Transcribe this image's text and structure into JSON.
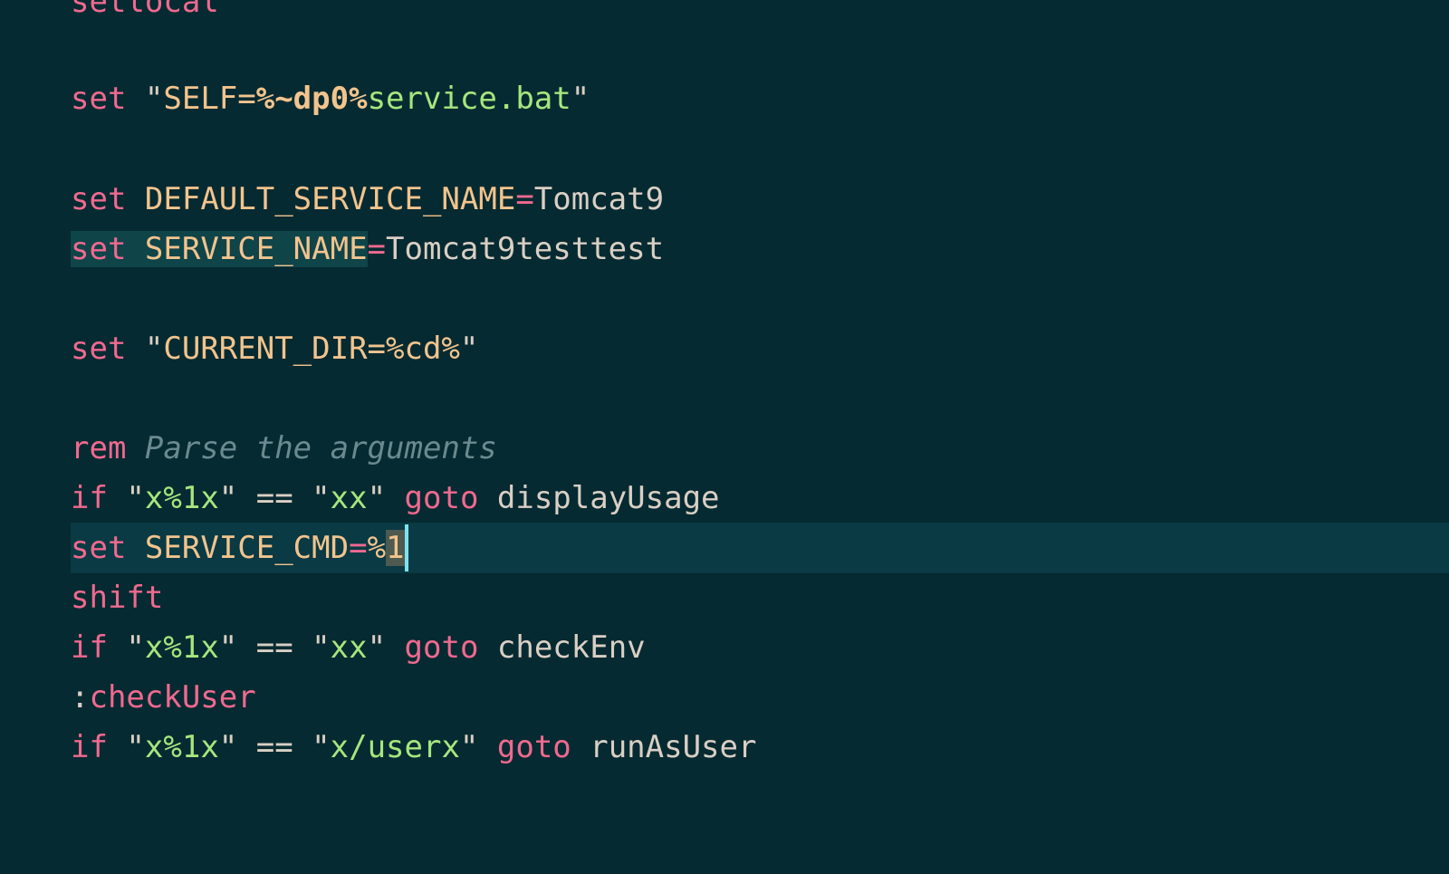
{
  "editor": {
    "lines": [
      {
        "t1": "setlocal"
      },
      {
        "t1": "set",
        "t2": " \"",
        "t3": "SELF=",
        "t4": "%~dp0%",
        "t5": "service.bat",
        "t6": "\""
      },
      {
        "t1": "set",
        "t2": " ",
        "t3": "DEFAULT_SERVICE_NAME",
        "t4": "=",
        "t5": "Tomcat9"
      },
      {
        "t1": "set",
        "t2": " ",
        "t3": "SERVICE_NAME",
        "t4": "=",
        "t5": "Tomcat9testtest"
      },
      {
        "t1": "set",
        "t2": " \"",
        "t3": "CURRENT_DIR=",
        "t4": "%cd%",
        "t5": "\""
      },
      {
        "t1": "rem",
        "t2": " ",
        "t3": "Parse the arguments"
      },
      {
        "t1": "if",
        "t2": " \"",
        "t3": "x%1x",
        "t4": "\" == \"",
        "t5": "xx",
        "t6": "\" ",
        "t7": "goto",
        "t8": " displayUsage"
      },
      {
        "t1": "set",
        "t2": " ",
        "t3": "SERVICE_CMD",
        "t4": "=",
        "t5": "%",
        "t6": "1"
      },
      {
        "t1": "shift"
      },
      {
        "t1": "if",
        "t2": " \"",
        "t3": "x%1x",
        "t4": "\" == \"",
        "t5": "xx",
        "t6": "\" ",
        "t7": "goto",
        "t8": " checkEnv"
      },
      {
        "t1": ":",
        "t2": "checkUser"
      },
      {
        "t1": "if",
        "t2": " \"",
        "t3": "x%1x",
        "t4": "\" == \"",
        "t5": "x/userx",
        "t6": "\" ",
        "t7": "goto",
        "t8": " runAsUser"
      }
    ]
  },
  "colors": {
    "background": "#062a31",
    "current_line": "#0a3a44",
    "keyword": "#f0698f",
    "variable": "#f2c48d",
    "string": "#a6e67d",
    "comment": "#6a8a8f",
    "cursor": "#7de3f2"
  }
}
